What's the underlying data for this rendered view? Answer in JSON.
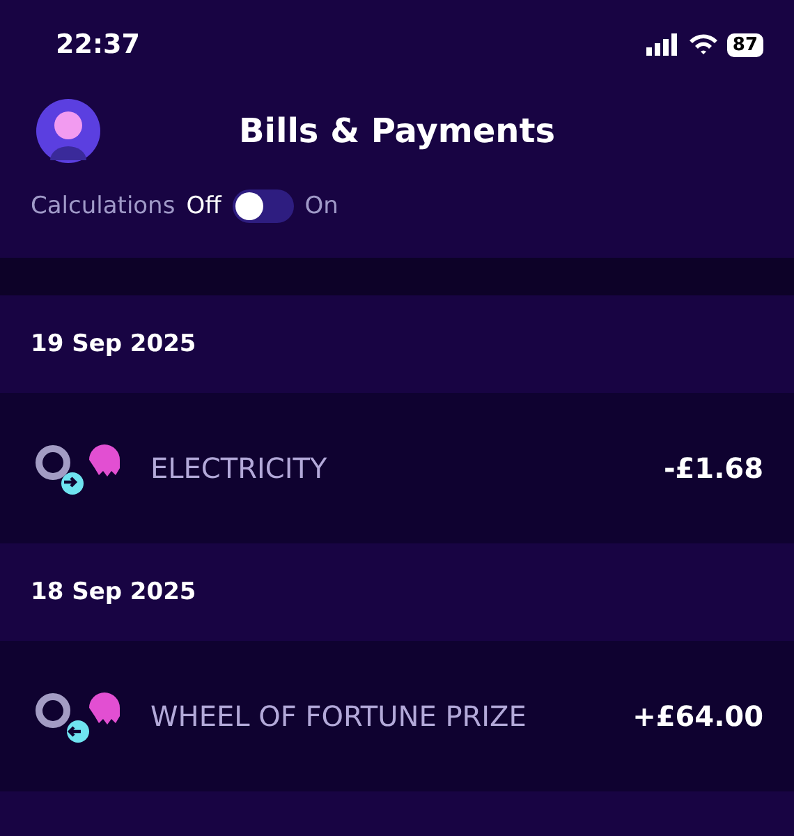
{
  "status_bar": {
    "time": "22:37",
    "battery": "87"
  },
  "header": {
    "title": "Bills & Payments"
  },
  "calculations": {
    "label": "Calculations",
    "off_label": "Off",
    "on_label": "On",
    "on": false
  },
  "groups": [
    {
      "date": "19 Sep 2025",
      "transactions": [
        {
          "name": "ELECTRICITY",
          "amount": "-£1.68",
          "kind": "out"
        }
      ]
    },
    {
      "date": "18 Sep 2025",
      "transactions": [
        {
          "name": "WHEEL OF FORTUNE PRIZE",
          "amount": "+£64.00",
          "kind": "in"
        }
      ]
    }
  ]
}
